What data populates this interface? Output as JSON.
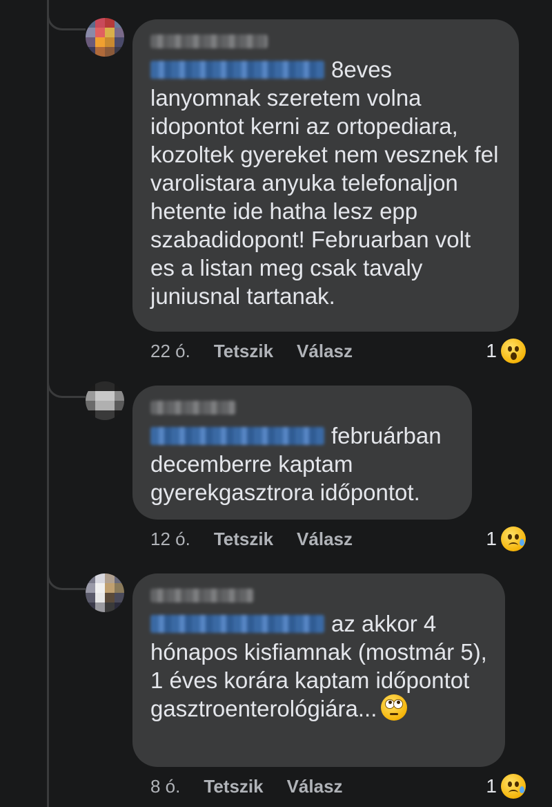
{
  "comments": [
    {
      "text": "8eves lanyomnak szeretem volna idopontot kerni az ortopediara, kozoltek gyereket nem vesznek fel varolistara anyuka telefonaljon hetente ide hatha lesz epp szabadidopont! Februarban volt es a listan meg csak tavaly juniusnal tartanak.",
      "time": "22 ó.",
      "like_label": "Tetszik",
      "reply_label": "Válasz",
      "reaction_count": "1",
      "reaction_icon": "wow-emoji-icon"
    },
    {
      "text": "februárban decemberre kaptam gyerekgasztrora időpontot.",
      "time": "12 ó.",
      "like_label": "Tetszik",
      "reply_label": "Válasz",
      "reaction_count": "1",
      "reaction_icon": "sad-emoji-icon"
    },
    {
      "text": "az akkor 4 hónapos kisfiamnak (mostmár 5), 1 éves korára kaptam időpontot gasztroenterológiára...",
      "inline_emoji": "eye-roll-emoji-icon",
      "time": "8 ó.",
      "like_label": "Tetszik",
      "reply_label": "Válasz",
      "reaction_count": "1",
      "reaction_icon": "sad-emoji-icon"
    }
  ],
  "colors": {
    "background": "#18191a",
    "bubble": "#3a3b3c",
    "text": "#e4e6eb",
    "meta_text": "#b0b3b8",
    "mention": "#4a7fc4"
  }
}
